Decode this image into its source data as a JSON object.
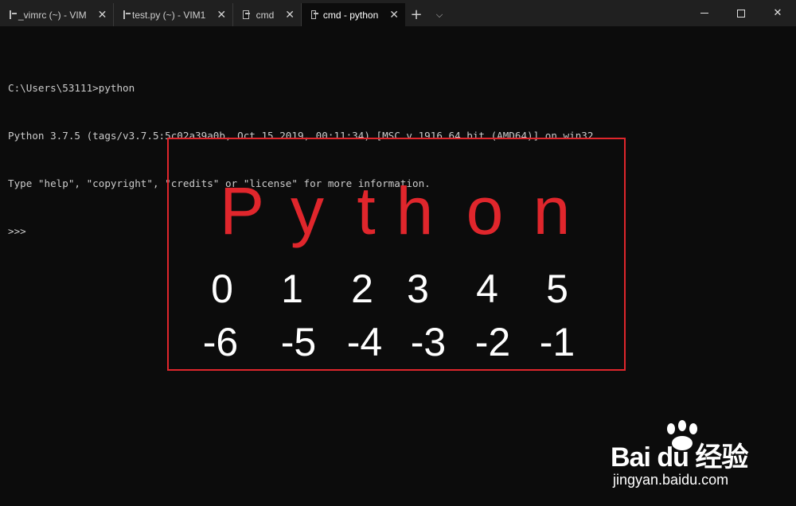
{
  "tabs": [
    {
      "title": "_vimrc (~) - VIM",
      "active": false
    },
    {
      "title": "test.py (~) - VIM1",
      "active": false
    },
    {
      "title": "cmd",
      "active": false
    },
    {
      "title": "cmd - python",
      "active": true
    }
  ],
  "tabbar": {
    "new_tab": "+",
    "dropdown": "⌵"
  },
  "window_controls": {
    "close": "✕"
  },
  "terminal": {
    "lines": [
      "C:\\Users\\53111>python",
      "Python 3.7.5 (tags/v3.7.5:5c02a39a0b, Oct 15 2019, 00:11:34) [MSC v.1916 64 bit (AMD64)] on win32",
      "Type \"help\", \"copyright\", \"credits\" or \"license\" for more information.",
      ">>>"
    ]
  },
  "overlay": {
    "word": [
      "P",
      "y",
      "t",
      "h",
      "o",
      "n"
    ],
    "positive_indices": [
      "0",
      "1",
      "2",
      "3",
      "4",
      "5"
    ],
    "negative_indices": [
      "-6",
      "-5",
      "-4",
      "-3",
      "-2",
      "-1"
    ],
    "border_color": "#e0262c",
    "word_color": "#e0262c"
  },
  "watermark": {
    "logo_text": "Bai du 经验",
    "url": "jingyan.baidu.com"
  }
}
